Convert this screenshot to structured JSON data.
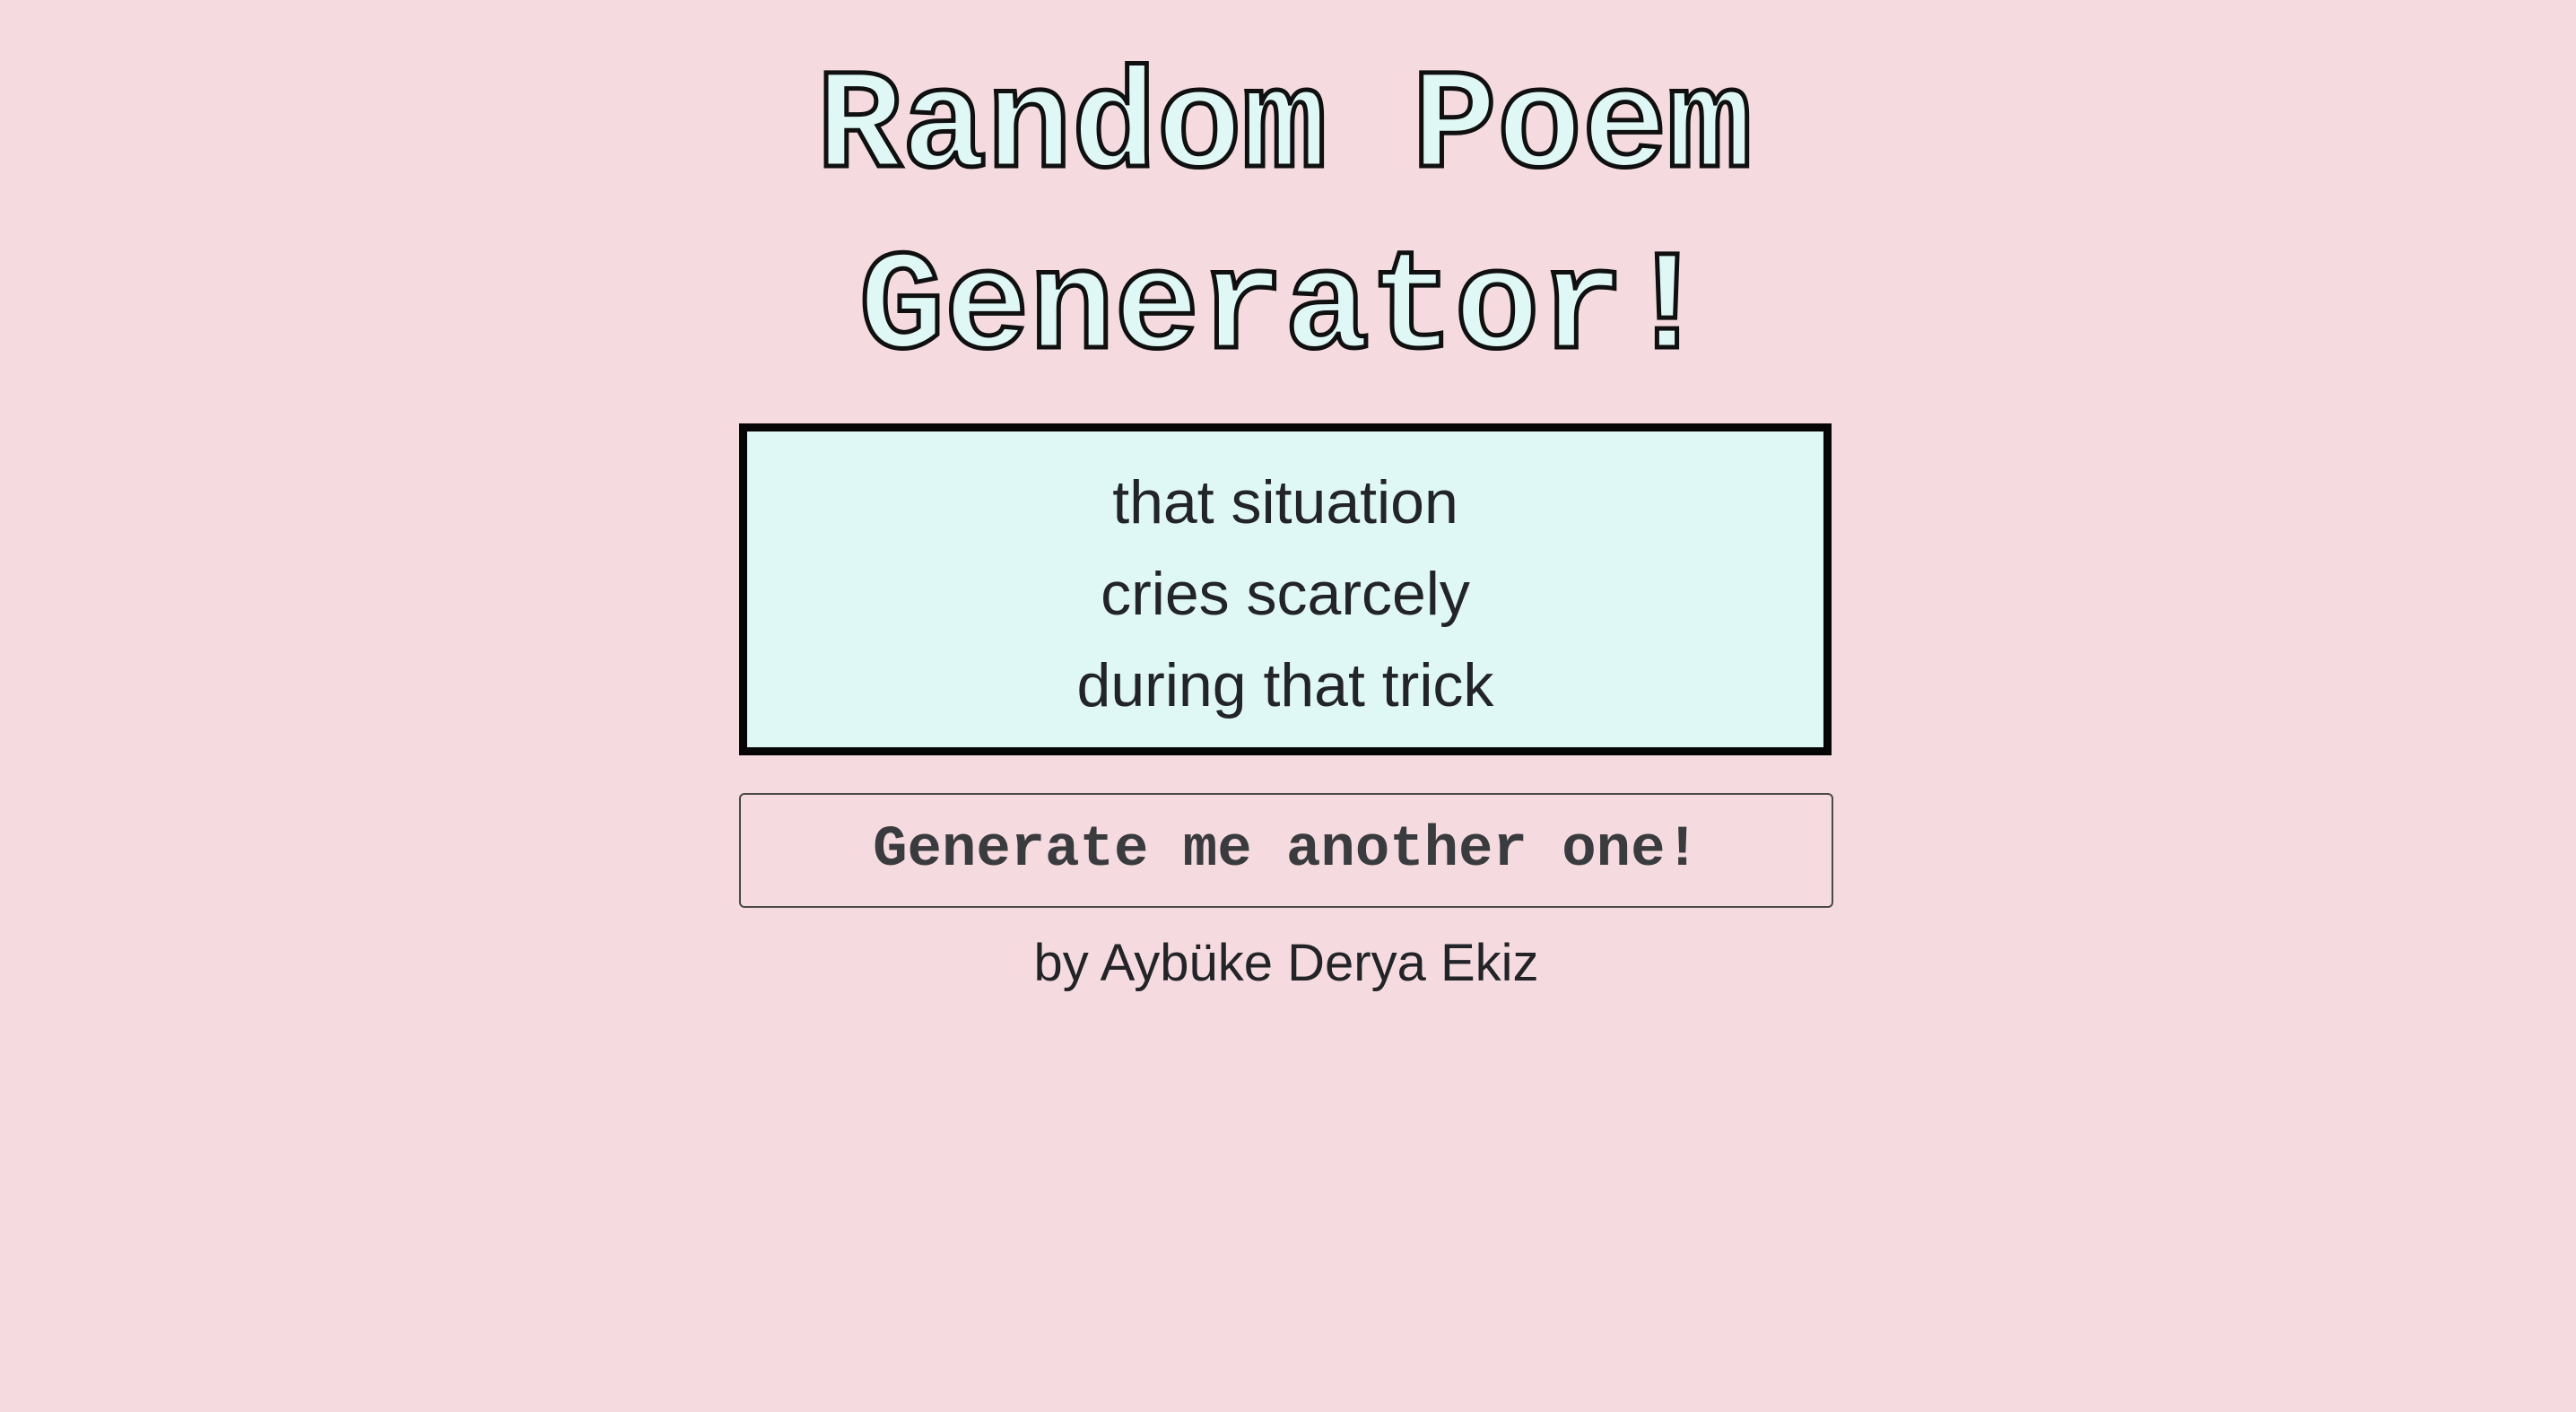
{
  "header": {
    "title_line1": "Random Poem",
    "title_line2": "Generator!"
  },
  "poem": {
    "lines": [
      "that situation",
      "cries scarcely",
      "during that trick"
    ]
  },
  "actions": {
    "generate_label": "Generate me another one!"
  },
  "footer": {
    "credit": "by Aybüke Derya Ekiz"
  },
  "colors": {
    "background": "#f5dbdf",
    "title_fill": "#dff8f5",
    "poem_box_background": "#dff8f5",
    "border": "#060606",
    "text": "#222428"
  }
}
